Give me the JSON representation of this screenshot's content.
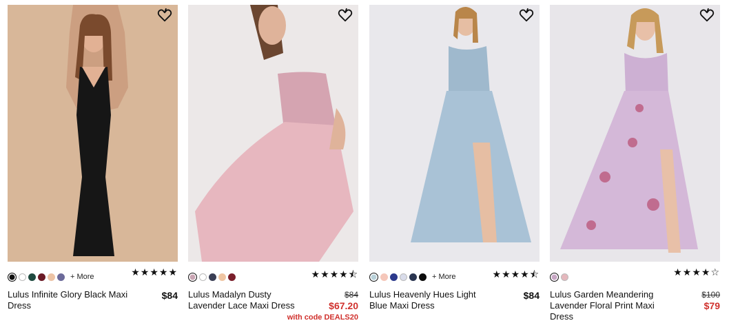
{
  "products": [
    {
      "name": "Lulus Infinite Glory Black Maxi Dress",
      "price": "$84",
      "rating": "★★★★★",
      "more_label": "+ More",
      "swatches": [
        "#0f0f0f",
        "#ffffff",
        "#1f4a40",
        "#6b1a26",
        "#ecc3a5",
        "#6c6a9a"
      ],
      "image_bg": "#d8b799",
      "dress_color": "#161616"
    },
    {
      "name": "Lulus Madalyn Dusty Lavender Lace Maxi Dress",
      "orig_price": "$84",
      "sale_price": "$67.20",
      "promo": "with code DEALS20",
      "rating": "★★★★⯪",
      "swatches": [
        "#c9a5b3",
        "#ffffff",
        "#3b3f55",
        "#efc5a2",
        "#7a1f2b"
      ],
      "image_bg": "#ece8e8",
      "dress_color": "#e7b7bf"
    },
    {
      "name": "Lulus Heavenly Hues Light Blue Maxi Dress",
      "price": "$84",
      "rating": "★★★★⯪",
      "more_label": "+ More",
      "swatches": [
        "#b8d1d9",
        "#f5c7ba",
        "#2d3a8c",
        "#d9dcea",
        "#2a3550",
        "#0c0c0c"
      ],
      "image_bg": "#e9e8ec",
      "dress_color": "#a9c2d6"
    },
    {
      "name": "Lulus Garden Meandering Lavender Floral Print Maxi Dress",
      "orig_price": "$100",
      "sale_price": "$79",
      "rating": "★★★★☆",
      "swatches": [
        "#c7a6c4",
        "#e5b8bd"
      ],
      "image_bg": "#e8e6ea",
      "dress_color": "#d4b8d8"
    }
  ],
  "colors": {
    "sale": "#d0312d",
    "text": "#111111"
  },
  "icons": {
    "favorite": "heart-outline-icon"
  }
}
